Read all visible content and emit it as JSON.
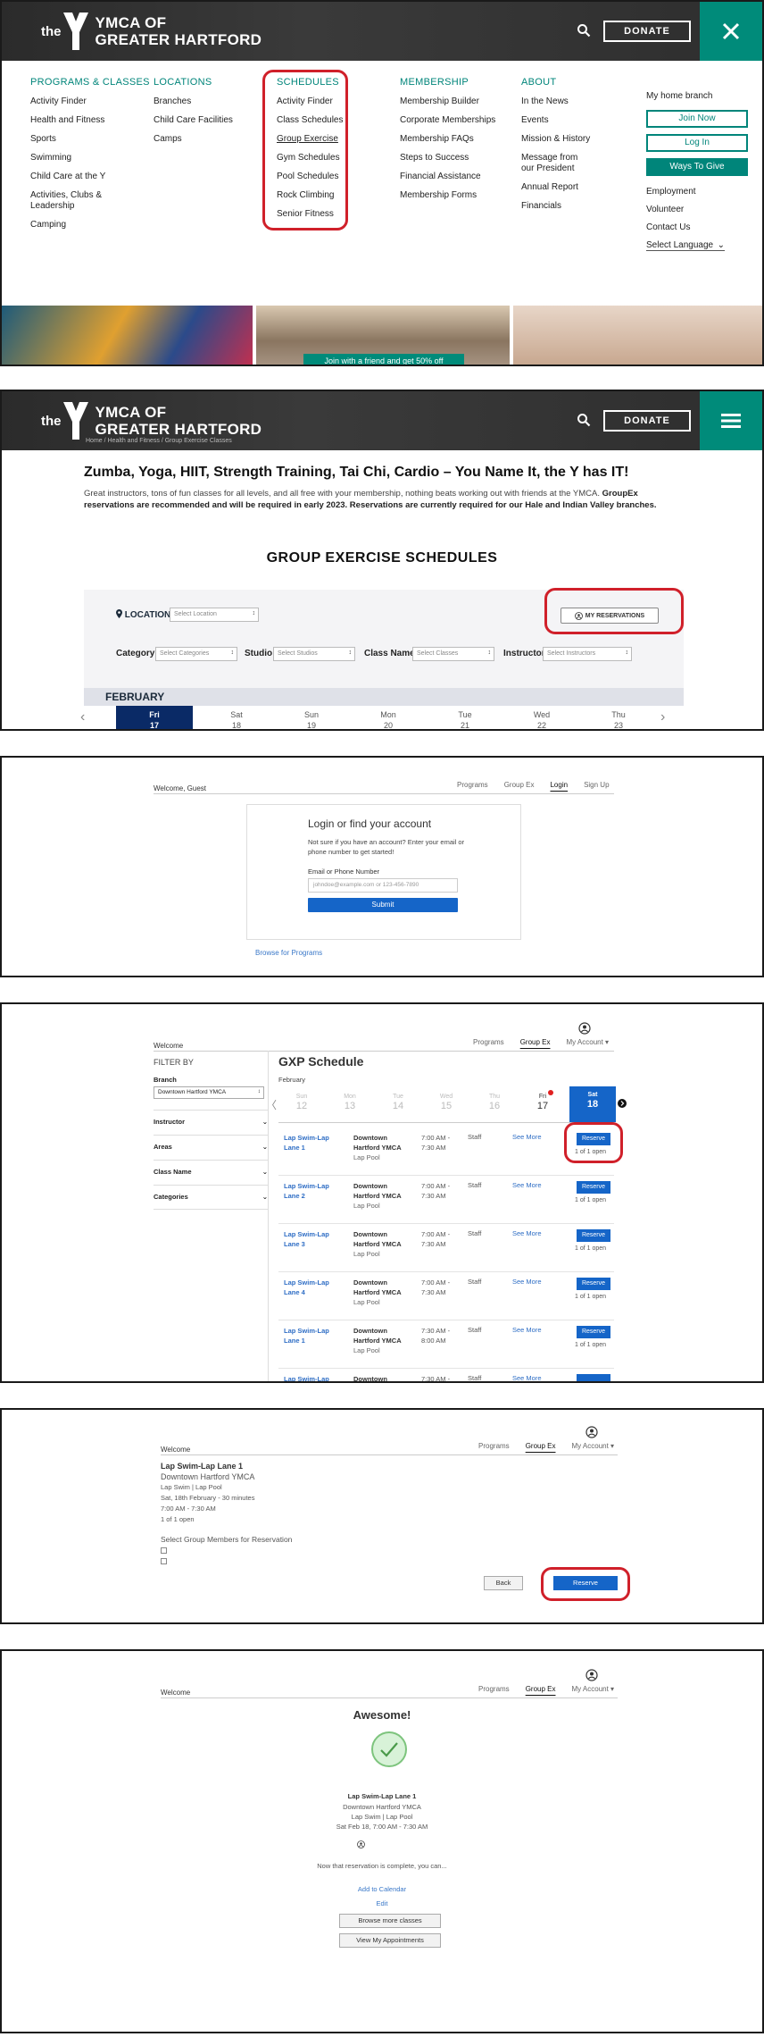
{
  "header": {
    "logo_the": "the",
    "logo_line1": "YMCA OF",
    "logo_line2": "GREATER HARTFORD",
    "donate": "DONATE"
  },
  "mega_menu": {
    "columns": [
      {
        "heading": "PROGRAMS & CLASSES",
        "items": [
          "Activity Finder",
          "Health and Fitness",
          "Sports",
          "Swimming",
          "Child Care at the Y",
          "Activities, Clubs & Leadership",
          "Camping"
        ]
      },
      {
        "heading": "LOCATIONS",
        "items": [
          "Branches",
          "Child Care Facilities",
          "Camps"
        ]
      },
      {
        "heading": "SCHEDULES",
        "items": [
          "Activity Finder",
          "Class Schedules",
          "Group Exercise",
          "Gym Schedules",
          "Pool Schedules",
          "Rock Climbing",
          "Senior Fitness"
        ]
      },
      {
        "heading": "MEMBERSHIP",
        "items": [
          "Membership Builder",
          "Corporate Memberships",
          "Membership FAQs",
          "Steps to Success",
          "Financial Assistance",
          "Membership Forms"
        ]
      },
      {
        "heading": "ABOUT",
        "items": [
          "In the News",
          "Events",
          "Mission & History",
          "Message from our President",
          "Annual Report",
          "Financials"
        ]
      }
    ],
    "side": {
      "home_branch": "My home branch",
      "join": "Join Now",
      "login": "Log In",
      "give": "Ways To Give",
      "links": [
        "Employment",
        "Volunteer",
        "Contact Us"
      ],
      "language": "Select Language"
    },
    "promo": "Join with a friend and get 50% off"
  },
  "groupex": {
    "breadcrumb": "Home  /  Health and Fitness  /  Group Exercise Classes",
    "title": "Zumba, Yoga, HIIT, Strength Training, Tai Chi, Cardio – You Name It, the Y has IT!",
    "desc_plain": "Great instructors, tons of fun classes for all levels, and all free with your membership, nothing beats working out with friends at the YMCA. ",
    "desc_bold": "GroupEx reservations are recommended and will be required in early 2023. Reservations are currently required for our Hale and Indian Valley branches.",
    "schedules_title": "GROUP EXERCISE SCHEDULES",
    "location_label": "LOCATION",
    "location_placeholder": "Select Location",
    "my_reservations": "MY RESERVATIONS",
    "filters": [
      {
        "label": "Category",
        "placeholder": "Select Categories"
      },
      {
        "label": "Studio",
        "placeholder": "Select Studios"
      },
      {
        "label": "Class Name",
        "placeholder": "Select Classes"
      },
      {
        "label": "Instructor",
        "placeholder": "Select Instructors"
      }
    ],
    "month": "FEBRUARY",
    "days": [
      {
        "dow": "Fri",
        "num": "17"
      },
      {
        "dow": "Sat",
        "num": "18"
      },
      {
        "dow": "Sun",
        "num": "19"
      },
      {
        "dow": "Mon",
        "num": "20"
      },
      {
        "dow": "Tue",
        "num": "21"
      },
      {
        "dow": "Wed",
        "num": "22"
      },
      {
        "dow": "Thu",
        "num": "23"
      }
    ]
  },
  "login": {
    "welcome": "Welcome, Guest",
    "nav": [
      "Programs",
      "Group Ex",
      "Login",
      "Sign Up"
    ],
    "title": "Login or find your account",
    "sub": "Not sure if you have an account? Enter your email or phone number to get started!",
    "field_label": "Email or Phone Number",
    "field_placeholder": "johndoe@example.com or 123-456-7890",
    "submit": "Submit",
    "browse": "Browse for Programs"
  },
  "gxp": {
    "welcome": "Welcome",
    "nav": [
      "Programs",
      "Group Ex",
      "My Account ▾"
    ],
    "filter_by": "FILTER BY",
    "branch_label": "Branch",
    "branch_value": "Downtown Hartford YMCA",
    "accordions": [
      "Instructor",
      "Areas",
      "Class Name",
      "Categories"
    ],
    "title": "GXP Schedule",
    "month": "February",
    "days": [
      {
        "dow": "Sun",
        "num": "12"
      },
      {
        "dow": "Mon",
        "num": "13"
      },
      {
        "dow": "Tue",
        "num": "14"
      },
      {
        "dow": "Wed",
        "num": "15"
      },
      {
        "dow": "Thu",
        "num": "16"
      },
      {
        "dow": "Fri",
        "num": "17"
      },
      {
        "dow": "Sat",
        "num": "18"
      }
    ],
    "rows": [
      {
        "class": "Lap Swim-Lap Lane 1",
        "branch": "Downtown Hartford YMCA",
        "facility": "Lap Pool",
        "time": "7:00 AM - 7:30 AM",
        "staff": "Staff",
        "see_more": "See More",
        "reserve": "Reserve",
        "open": "1 of 1 open"
      },
      {
        "class": "Lap Swim-Lap Lane 2",
        "branch": "Downtown Hartford YMCA",
        "facility": "Lap Pool",
        "time": "7:00 AM - 7:30 AM",
        "staff": "Staff",
        "see_more": "See More",
        "reserve": "Reserve",
        "open": "1 of 1 open"
      },
      {
        "class": "Lap Swim-Lap Lane 3",
        "branch": "Downtown Hartford YMCA",
        "facility": "Lap Pool",
        "time": "7:00 AM - 7:30 AM",
        "staff": "Staff",
        "see_more": "See More",
        "reserve": "Reserve",
        "open": "1 of 1 open"
      },
      {
        "class": "Lap Swim-Lap Lane 4",
        "branch": "Downtown Hartford YMCA",
        "facility": "Lap Pool",
        "time": "7:00 AM - 7:30 AM",
        "staff": "Staff",
        "see_more": "See More",
        "reserve": "Reserve",
        "open": "1 of 1 open"
      },
      {
        "class": "Lap Swim-Lap Lane 1",
        "branch": "Downtown Hartford YMCA",
        "facility": "Lap Pool",
        "time": "7:30 AM - 8:00 AM",
        "staff": "Staff",
        "see_more": "See More",
        "reserve": "Reserve",
        "open": "1 of 1 open"
      },
      {
        "class": "Lap Swim-Lap",
        "branch": "Downtown Hartford",
        "facility": "",
        "time": "7:30 AM -",
        "staff": "Staff",
        "see_more": "See More",
        "reserve": "",
        "open": ""
      }
    ]
  },
  "reservation": {
    "welcome": "Welcome",
    "nav": [
      "Programs",
      "Group Ex",
      "My Account ▾"
    ],
    "class": "Lap Swim-Lap Lane 1",
    "branch": "Downtown Hartford YMCA",
    "facility": "Lap Swim | Lap Pool",
    "date": "Sat, 18th February - 30 minutes",
    "time": "7:00 AM - 7:30 AM",
    "open": "1 of 1 open",
    "members_label": "Select Group Members for Reservation",
    "back": "Back",
    "reserve": "Reserve"
  },
  "confirmation": {
    "welcome": "Welcome",
    "nav": [
      "Programs",
      "Group Ex",
      "My Account ▾"
    ],
    "title": "Awesome!",
    "class": "Lap Swim-Lap Lane 1",
    "branch": "Downtown Hartford YMCA",
    "facility": "Lap Swim | Lap Pool",
    "datetime": "Sat Feb 18, 7:00 AM - 7:30 AM",
    "complete": "Now that reservation is complete, you can...",
    "add_calendar": "Add to Calendar",
    "edit": "Edit",
    "browse_more": "Browse more classes",
    "view_appts": "View My Appointments"
  },
  "colors": {
    "brand_teal": "#00857a",
    "button_blue": "#1565c8",
    "highlight_red": "#d0202a",
    "nav_navy": "#0a2a66"
  }
}
